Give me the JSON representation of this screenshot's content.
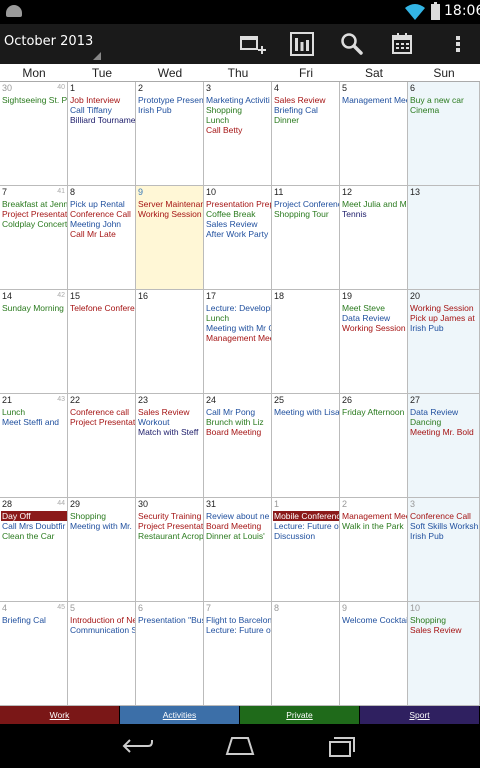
{
  "statusbar": {
    "time": "18:06"
  },
  "header": {
    "month_title": "October 2013"
  },
  "toolbar": {
    "icons": [
      "add-calendar-icon",
      "view-mode-icon",
      "search-icon",
      "today-icon",
      "overflow-menu-icon"
    ]
  },
  "weekdays": [
    "Mon",
    "Tue",
    "Wed",
    "Thu",
    "Fri",
    "Sat",
    "Sun"
  ],
  "colors": {
    "work": "#7a1717",
    "activities": "#3c6fa8",
    "private": "#1f6a1a",
    "sport": "#2f2060"
  },
  "weeks": [
    {
      "week_no": "40",
      "days": [
        {
          "d": "30",
          "other": true,
          "events": [
            {
              "t": "Sightseeing St. Pe",
              "c": "green"
            }
          ]
        },
        {
          "d": "1",
          "events": [
            {
              "t": "Job Interview",
              "c": "red"
            },
            {
              "t": "Call Tiffany",
              "c": "blue"
            },
            {
              "t": "Billiard Tourname",
              "c": "navy"
            }
          ]
        },
        {
          "d": "2",
          "events": [
            {
              "t": "Prototype Present",
              "c": "blue"
            },
            {
              "t": "Irish Pub",
              "c": "blue"
            }
          ]
        },
        {
          "d": "3",
          "events": [
            {
              "t": "Marketing Activiti",
              "c": "blue"
            },
            {
              "t": "Shopping",
              "c": "green"
            },
            {
              "t": "Lunch",
              "c": "green"
            },
            {
              "t": "Call Betty",
              "c": "red"
            }
          ]
        },
        {
          "d": "4",
          "events": [
            {
              "t": "Sales Review",
              "c": "red"
            },
            {
              "t": "Briefing Cal",
              "c": "blue"
            },
            {
              "t": "Dinner",
              "c": "green"
            }
          ]
        },
        {
          "d": "5",
          "events": [
            {
              "t": "Management Mee",
              "c": "blue"
            }
          ]
        },
        {
          "d": "6",
          "events": [
            {
              "t": "Buy a new car",
              "c": "green"
            },
            {
              "t": "Cinema",
              "c": "green"
            }
          ]
        }
      ]
    },
    {
      "week_no": "41",
      "days": [
        {
          "d": "7",
          "events": [
            {
              "t": "Breakfast at Jenn",
              "c": "green"
            },
            {
              "t": "Project Presentati",
              "c": "red"
            },
            {
              "t": "Coldplay Concert",
              "c": "green"
            }
          ]
        },
        {
          "d": "8",
          "events": [
            {
              "t": "Pick up Rental",
              "c": "blue"
            },
            {
              "t": "Conference Call",
              "c": "red"
            },
            {
              "t": "Meeting John",
              "c": "blue"
            },
            {
              "t": "Call Mr Late",
              "c": "red"
            }
          ]
        },
        {
          "d": "9",
          "today": true,
          "events": [
            {
              "t": "Server Maintenan",
              "c": "red"
            },
            {
              "t": "Working Session",
              "c": "red"
            }
          ]
        },
        {
          "d": "10",
          "events": [
            {
              "t": "Presentation Prep",
              "c": "red"
            },
            {
              "t": "Coffee Break",
              "c": "green"
            },
            {
              "t": "Sales Review",
              "c": "blue"
            },
            {
              "t": "After Work Party",
              "c": "blue"
            }
          ]
        },
        {
          "d": "11",
          "events": [
            {
              "t": "Project Conferenc",
              "c": "blue"
            },
            {
              "t": "Shopping Tour",
              "c": "green"
            }
          ]
        },
        {
          "d": "12",
          "events": [
            {
              "t": "Meet Julia and Mi",
              "c": "green"
            },
            {
              "t": "Tennis",
              "c": "navy"
            }
          ]
        },
        {
          "d": "13",
          "events": []
        }
      ]
    },
    {
      "week_no": "42",
      "days": [
        {
          "d": "14",
          "events": [
            {
              "t": "Sunday Morning",
              "c": "green"
            }
          ]
        },
        {
          "d": "15",
          "events": [
            {
              "t": "Telefone Confere",
              "c": "red"
            }
          ]
        },
        {
          "d": "16",
          "events": []
        },
        {
          "d": "17",
          "events": [
            {
              "t": "Lecture: Developi",
              "c": "blue"
            },
            {
              "t": "Lunch",
              "c": "green"
            },
            {
              "t": "Meeting with Mr G",
              "c": "blue"
            },
            {
              "t": "Management Mee",
              "c": "red"
            }
          ]
        },
        {
          "d": "18",
          "events": []
        },
        {
          "d": "19",
          "events": [
            {
              "t": "Meet Steve",
              "c": "green"
            },
            {
              "t": "Data Review",
              "c": "blue"
            },
            {
              "t": "Working Session",
              "c": "red"
            }
          ]
        },
        {
          "d": "20",
          "events": [
            {
              "t": "Working Session",
              "c": "red"
            },
            {
              "t": "Pick up James at",
              "c": "red"
            },
            {
              "t": "Irish Pub",
              "c": "blue"
            }
          ]
        }
      ]
    },
    {
      "week_no": "43",
      "days": [
        {
          "d": "21",
          "events": [
            {
              "t": "Lunch",
              "c": "green"
            },
            {
              "t": "Meet Steffi and",
              "c": "blue"
            }
          ]
        },
        {
          "d": "22",
          "events": [
            {
              "t": "Conference call",
              "c": "red"
            },
            {
              "t": "Project Presentati",
              "c": "red"
            }
          ]
        },
        {
          "d": "23",
          "events": [
            {
              "t": "Sales Review",
              "c": "red"
            },
            {
              "t": "Workout",
              "c": "blue"
            },
            {
              "t": "Match with Steff",
              "c": "navy"
            }
          ]
        },
        {
          "d": "24",
          "events": [
            {
              "t": "Call Mr Pong",
              "c": "blue"
            },
            {
              "t": "Brunch with Liz",
              "c": "green"
            },
            {
              "t": "Board Meeting",
              "c": "red"
            }
          ]
        },
        {
          "d": "25",
          "events": [
            {
              "t": "Meeting with Lisa,",
              "c": "blue"
            }
          ]
        },
        {
          "d": "26",
          "events": [
            {
              "t": "Friday Afternoon",
              "c": "green"
            }
          ]
        },
        {
          "d": "27",
          "events": [
            {
              "t": "Data Review",
              "c": "blue"
            },
            {
              "t": "Dancing",
              "c": "green"
            },
            {
              "t": "Meeting Mr. Bold",
              "c": "red"
            }
          ]
        }
      ]
    },
    {
      "week_no": "44",
      "days": [
        {
          "d": "28",
          "events": [
            {
              "t": "Day Off",
              "c": "fill"
            },
            {
              "t": "Call Mrs Doubtfir",
              "c": "blue"
            },
            {
              "t": "Clean the Car",
              "c": "green"
            }
          ]
        },
        {
          "d": "29",
          "events": [
            {
              "t": "Shopping",
              "c": "green"
            },
            {
              "t": "Meeting with Mr.",
              "c": "blue"
            }
          ]
        },
        {
          "d": "30",
          "events": [
            {
              "t": "Security Training",
              "c": "red"
            },
            {
              "t": "Project Presentati",
              "c": "red"
            },
            {
              "t": "Restaurant Acrop",
              "c": "green"
            }
          ]
        },
        {
          "d": "31",
          "events": [
            {
              "t": "Review about ne",
              "c": "blue"
            },
            {
              "t": "Board Meeting",
              "c": "red"
            },
            {
              "t": "Dinner at Louis'",
              "c": "green"
            }
          ]
        },
        {
          "d": "1",
          "other": true,
          "events": [
            {
              "t": "Mobile Conferenc",
              "c": "fill"
            },
            {
              "t": "Lecture: Future of",
              "c": "blue"
            },
            {
              "t": "Discussion",
              "c": "blue"
            }
          ]
        },
        {
          "d": "2",
          "other": true,
          "events": [
            {
              "t": "Management Mee",
              "c": "red"
            },
            {
              "t": "Walk in the Park",
              "c": "green"
            }
          ]
        },
        {
          "d": "3",
          "other": true,
          "events": [
            {
              "t": "Conference Call",
              "c": "red"
            },
            {
              "t": "Soft Skills Worksh",
              "c": "blue"
            },
            {
              "t": "Irish Pub",
              "c": "blue"
            }
          ]
        }
      ]
    },
    {
      "week_no": "45",
      "days": [
        {
          "d": "4",
          "other": true,
          "events": [
            {
              "t": "Briefing Cal",
              "c": "blue"
            }
          ]
        },
        {
          "d": "5",
          "other": true,
          "events": [
            {
              "t": "Introduction of Ne",
              "c": "red"
            },
            {
              "t": "Communication S",
              "c": "blue"
            }
          ]
        },
        {
          "d": "6",
          "other": true,
          "events": [
            {
              "t": "Presentation \"Bus",
              "c": "blue"
            }
          ]
        },
        {
          "d": "7",
          "other": true,
          "events": [
            {
              "t": "Flight to Barcelon",
              "c": "blue"
            },
            {
              "t": "Lecture: Future of",
              "c": "blue"
            }
          ]
        },
        {
          "d": "8",
          "other": true,
          "events": []
        },
        {
          "d": "9",
          "other": true,
          "events": [
            {
              "t": "Welcome Cocktai",
              "c": "blue"
            }
          ]
        },
        {
          "d": "10",
          "other": true,
          "events": [
            {
              "t": "Shopping",
              "c": "green"
            },
            {
              "t": "Sales Review",
              "c": "red"
            }
          ]
        }
      ]
    }
  ],
  "legend": [
    {
      "label": "Work",
      "color": "#7a1717"
    },
    {
      "label": "Activities",
      "color": "#3c6fa8"
    },
    {
      "label": "Private",
      "color": "#1f6a1a"
    },
    {
      "label": "Sport",
      "color": "#2f2060"
    }
  ]
}
